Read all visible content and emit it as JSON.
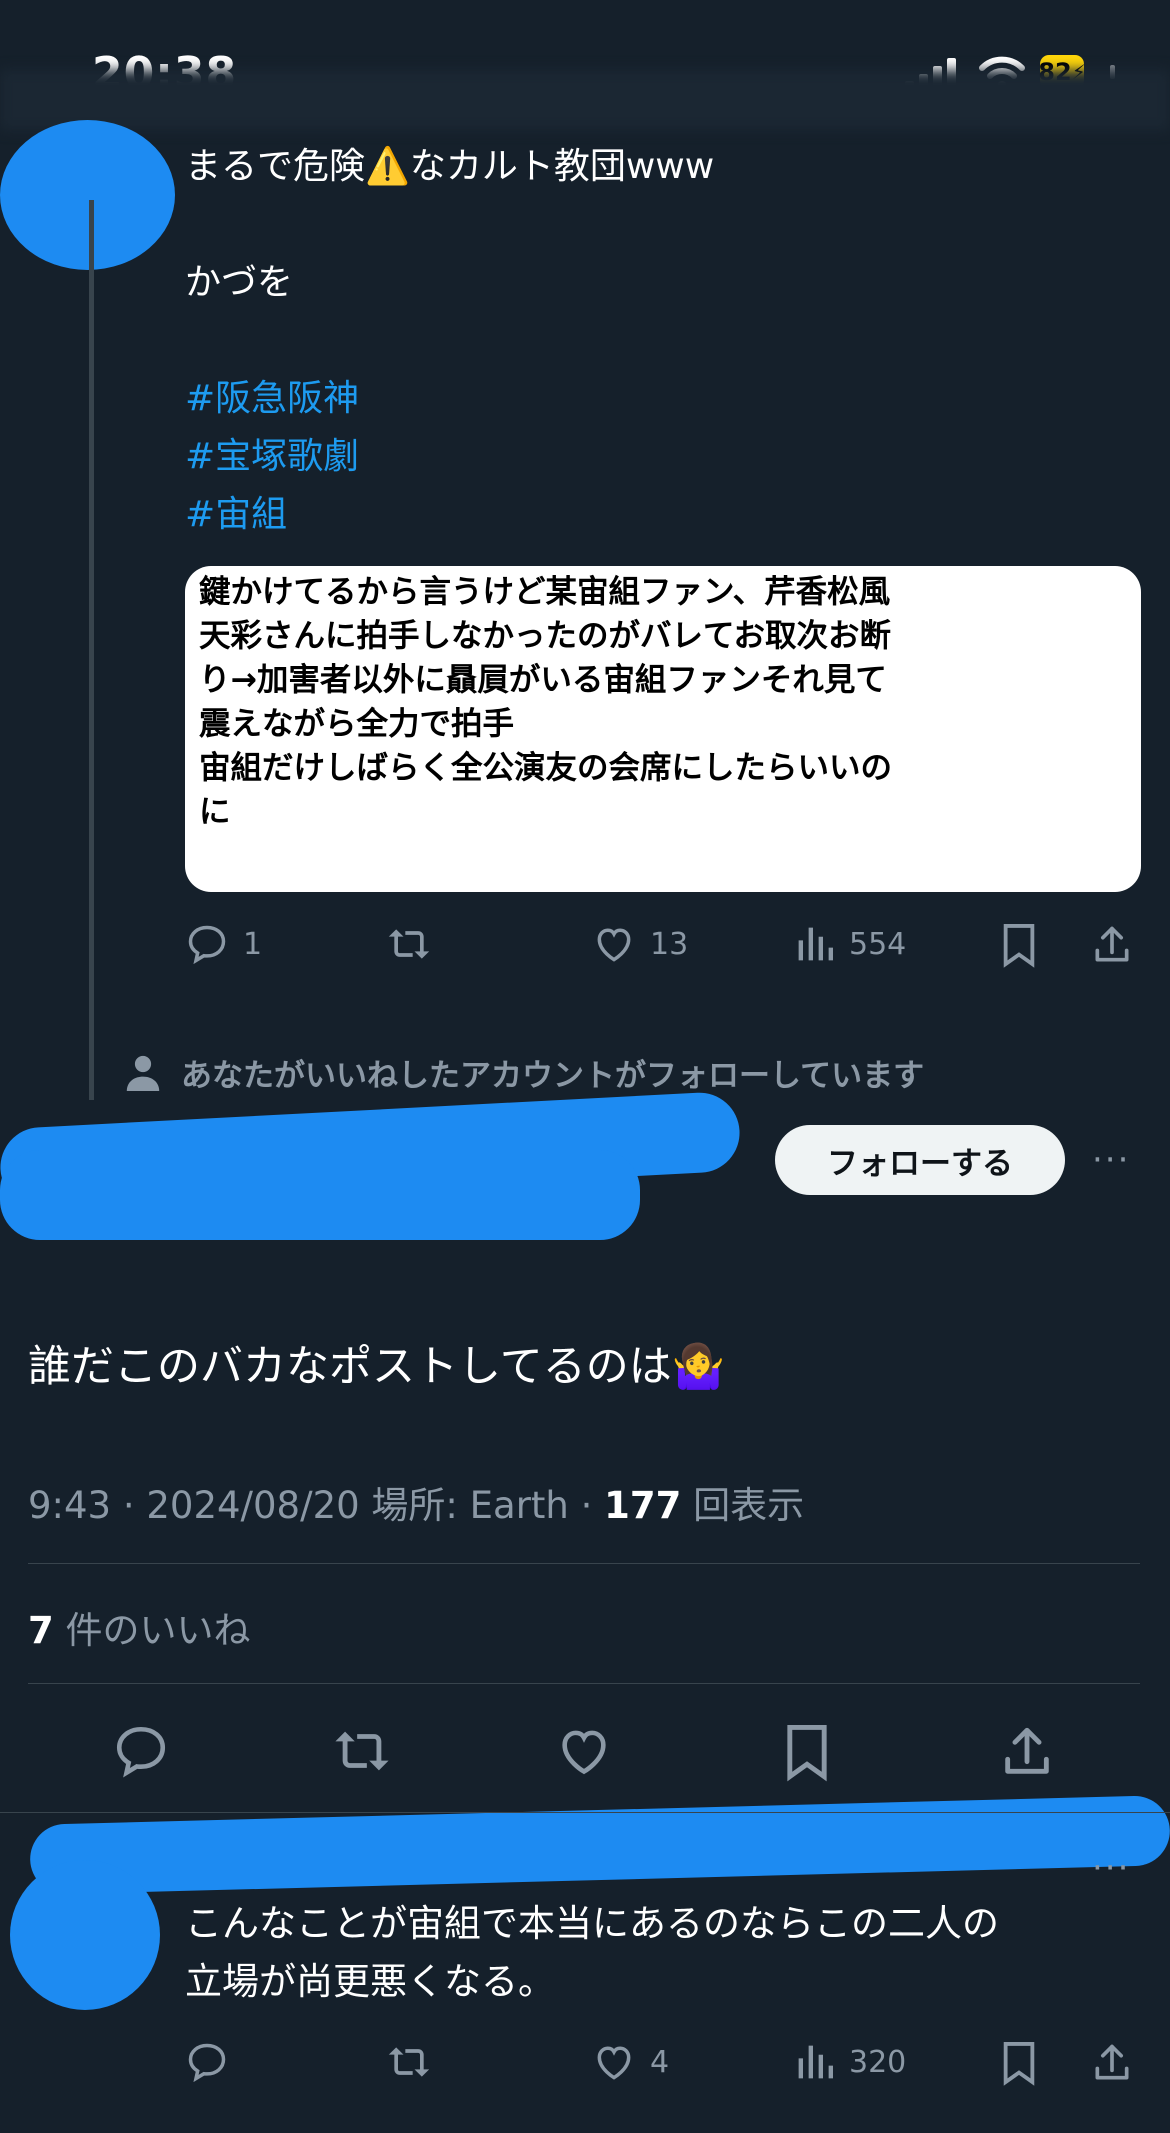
{
  "status_bar": {
    "time": "20:38",
    "battery": "82"
  },
  "quoted_post": {
    "text_line1": "まるで危険⚠️なカルト教団www",
    "text_line2": "かづを",
    "hashtags": [
      "#阪急阪神",
      "#宝塚歌劇",
      "#宙組"
    ],
    "image_text": [
      "鍵かけてるから言うけど某宙組ファン、芹香松風",
      "天彩さんに拍手しなかったのがバレてお取次お断",
      "り→加害者以外に贔屓がいる宙組ファンそれ見て",
      "震えながら全力で拍手",
      "宙組だけしばらく全公演友の会席にしたらいいの",
      "に"
    ],
    "actions": {
      "replies": "1",
      "reposts": "",
      "likes": "13",
      "views": "554"
    }
  },
  "social_context": "あなたがいいねしたアカウントがフォローしています",
  "follow_button": "フォローする",
  "main_post": {
    "text": "誰だこのバカなポストしてるのは🤷‍♀️",
    "time": "9:43",
    "date": "2024/08/20",
    "location": "場所: Earth",
    "views_count": "177",
    "views_label": "回表示",
    "likes_count": "7",
    "likes_label": "件のいいね"
  },
  "reply_post": {
    "text_line1": "こんなことが宙組で本当にあるのならこの二人の",
    "text_line2": "立場が尚更悪くなる。",
    "actions": {
      "replies": "",
      "reposts": "",
      "likes": "4",
      "views": "320"
    }
  },
  "colors": {
    "background": "#15202b",
    "accent": "#1d9bf0",
    "muted": "#8b98a5",
    "battery": "#ffd60a"
  },
  "icons": [
    "signal-icon",
    "wifi-icon",
    "battery-icon",
    "reply-icon",
    "repost-icon",
    "like-icon",
    "views-icon",
    "bookmark-icon",
    "share-icon",
    "person-icon",
    "more-icon"
  ]
}
